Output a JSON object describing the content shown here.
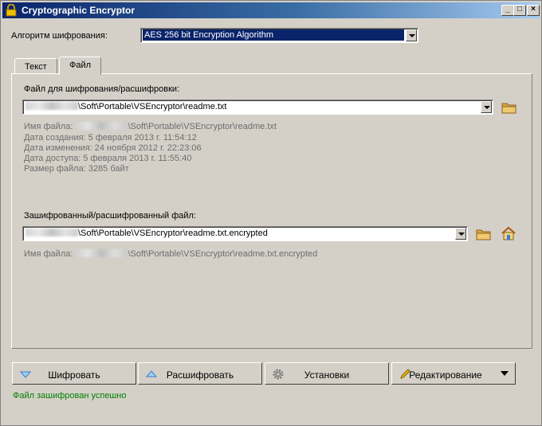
{
  "window": {
    "title": "Cryptographic Encryptor",
    "buttons": {
      "minimize": "_",
      "maximize": "□",
      "close": "×"
    }
  },
  "algorithm": {
    "label": "Алгоритм шифрования:",
    "value": "AES 256 bit Encryption Algorithm"
  },
  "tabs": [
    {
      "label": "Текст",
      "active": false
    },
    {
      "label": "Файл",
      "active": true
    }
  ],
  "source": {
    "label": "Файл для шифрования/расшифровки:",
    "path_suffix": "\\Soft\\Portable\\VSEncryptor\\readme.txt",
    "info": {
      "name_label": "Имя файла: ",
      "name_suffix": "\\Soft\\Portable\\VSEncryptor\\readme.txt",
      "created": "Дата создания: 5 февраля 2013 г. 11:54:12",
      "modified": "Дата изменения: 24 ноября 2012 г. 22:23:06",
      "accessed": "Дата доступа: 5 февраля 2013 г. 11:55:40",
      "size": "Размер файла: 3285 байт"
    }
  },
  "destination": {
    "label": "Зашифрованный/расшифрованный файл:",
    "path_suffix": "\\Soft\\Portable\\VSEncryptor\\readme.txt.encrypted",
    "info": {
      "name_label": "Имя файла: ",
      "name_suffix": "\\Soft\\Portable\\VSEncryptor\\readme.txt.encrypted"
    }
  },
  "buttons": {
    "encrypt": "Шифровать",
    "decrypt": "Расшифровать",
    "settings": "Установки",
    "edit": "Редактирование"
  },
  "status": "Файл зашифрован успешно",
  "colors": {
    "titlebar_start": "#0a246a",
    "titlebar_end": "#a6caf0",
    "status_text": "#008000",
    "face": "#d4d0c8"
  }
}
